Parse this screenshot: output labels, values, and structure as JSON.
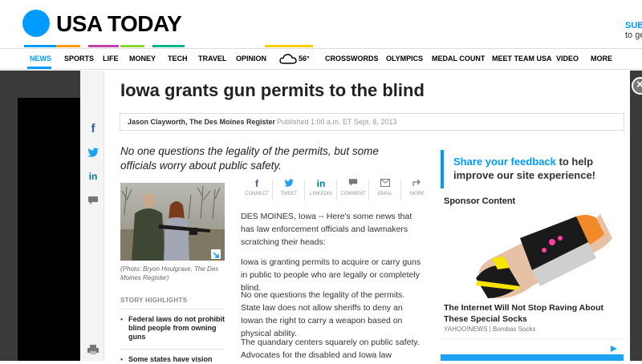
{
  "brand": {
    "logo_text": "USA TODAY",
    "logo_color": "#009bff"
  },
  "subscribe": {
    "line1": "SUB",
    "line2": "to get"
  },
  "nav": {
    "items": [
      "NEWS",
      "SPORTS",
      "LIFE",
      "MONEY",
      "TECH",
      "TRAVEL",
      "OPINION",
      "CROSSWORDS",
      "OLYMPICS",
      "MEDAL COUNT",
      "MEET TEAM USA",
      "VIDEO",
      "MORE"
    ],
    "active": "NEWS",
    "weather_temp": "56°"
  },
  "article": {
    "headline": "Iowa grants gun permits to the blind",
    "author": "Jason Clayworth, The Des Moines Register",
    "published": "Published 1:00 a.m. ET Sept. 8, 2013",
    "dek": "No one questions the legality of the permits, but some officials worry about public safety.",
    "photo_credit": "(Photo: Bryon Houlgrave, The Des Moines Register)",
    "highlights_title": "STORY HIGHLIGHTS",
    "highlights": [
      "Federal laws do not prohibit blind people from owning guns",
      "Some states have vision"
    ],
    "share": [
      {
        "icon": "facebook-icon",
        "label": "CONNECT",
        "glyph": "f"
      },
      {
        "icon": "twitter-icon",
        "label": "TWEET",
        "glyph": "🐦"
      },
      {
        "icon": "linkedin-icon",
        "label": "LINKEDIN",
        "glyph": "in"
      },
      {
        "icon": "comment-icon",
        "label": "COMMENT",
        "glyph": "💬"
      },
      {
        "icon": "email-icon",
        "label": "EMAIL",
        "glyph": "✉"
      },
      {
        "icon": "more-icon",
        "label": "MORE",
        "glyph": "↗"
      }
    ],
    "paragraphs": [
      "DES MOINES, Iowa -- Here's some news that has law enforcement officials and lawmakers scratching their heads:",
      "Iowa is granting permits to acquire or carry guns in public to people who are legally or completely blind.",
      "No one questions the legality of the permits. State law does not allow sheriffs to deny an Iowan the right to carry a weapon based on physical ability.",
      "The quandary centers squarely on public safety. Advocates for the disabled and Iowa law"
    ]
  },
  "sidebar": {
    "feedback_link": "Share your feedback",
    "feedback_rest": " to help improve our site experience!",
    "sponsor_title": "Sponsor Content",
    "sponsor_headline": "The Internet Will Not Stop Raving About These Special Socks",
    "sponsor_source": "YAHOO!NEWS | Bombas Socks"
  }
}
